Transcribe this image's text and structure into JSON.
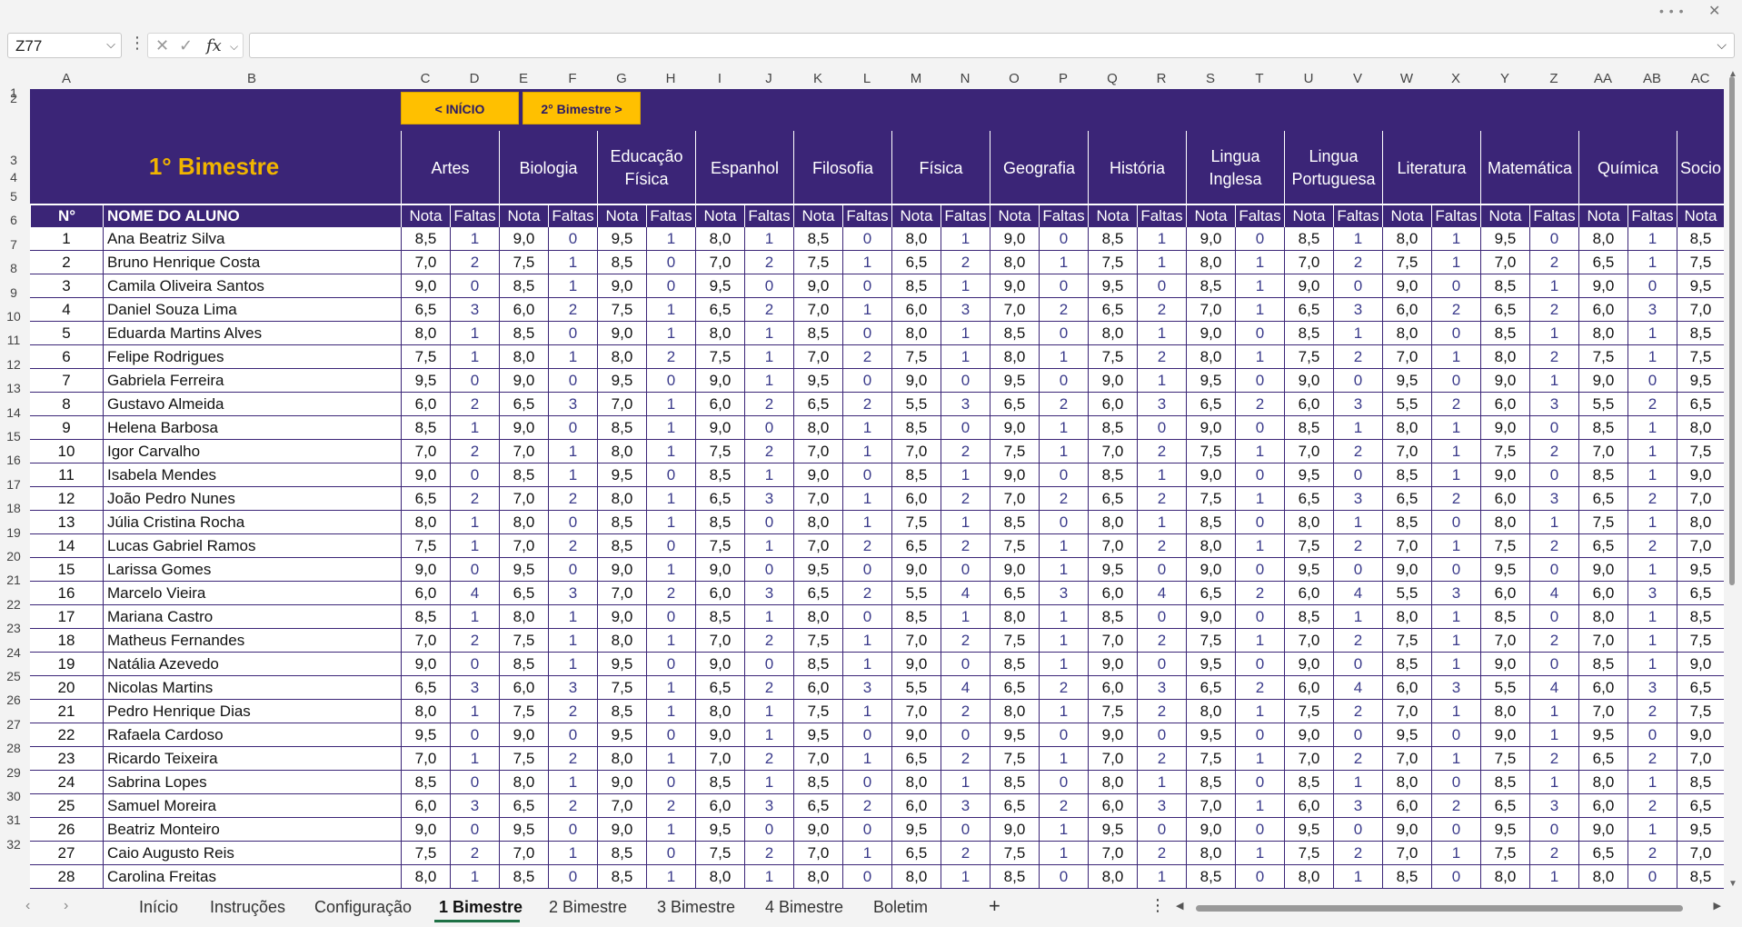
{
  "namebox": "Z77",
  "fx_label": "fx",
  "columns": [
    "A",
    "B",
    "C",
    "D",
    "E",
    "F",
    "G",
    "H",
    "I",
    "J",
    "K",
    "L",
    "M",
    "N",
    "O",
    "P",
    "Q",
    "R",
    "S",
    "T",
    "U",
    "V",
    "W",
    "X",
    "Y",
    "Z",
    "AA",
    "AB",
    "AC"
  ],
  "row_numbers": [
    "1",
    "2",
    "3",
    "4",
    "5",
    "6",
    "7",
    "8",
    "9",
    "10",
    "11",
    "12",
    "13",
    "14",
    "15",
    "16",
    "17",
    "18",
    "19",
    "20",
    "21",
    "22",
    "23",
    "24",
    "25",
    "26",
    "27",
    "28",
    "29",
    "30",
    "31",
    "32"
  ],
  "nav": {
    "inicio": "< INÍCIO",
    "next": "2° Bimestre >"
  },
  "title": "1° Bimestre",
  "subjects": [
    {
      "l1": "Artes",
      "l2": ""
    },
    {
      "l1": "Biologia",
      "l2": ""
    },
    {
      "l1": "Educação",
      "l2": "Física"
    },
    {
      "l1": "Espanhol",
      "l2": ""
    },
    {
      "l1": "Filosofia",
      "l2": ""
    },
    {
      "l1": "Física",
      "l2": ""
    },
    {
      "l1": "Geografia",
      "l2": ""
    },
    {
      "l1": "História",
      "l2": ""
    },
    {
      "l1": "Lingua",
      "l2": "Inglesa"
    },
    {
      "l1": "Lingua",
      "l2": "Portuguesa"
    },
    {
      "l1": "Literatura",
      "l2": ""
    },
    {
      "l1": "Matemática",
      "l2": ""
    },
    {
      "l1": "Química",
      "l2": ""
    },
    {
      "l1": "Socio",
      "l2": ""
    }
  ],
  "headers": {
    "num": "N°",
    "name": "NOME DO ALUNO",
    "nota": "Nota",
    "faltas": "Faltas"
  },
  "students": [
    {
      "n": "1",
      "name": "Ana Beatriz Silva",
      "g": [
        "8,5",
        "1",
        "9,0",
        "0",
        "9,5",
        "1",
        "8,0",
        "1",
        "8,5",
        "0",
        "8,0",
        "1",
        "9,0",
        "0",
        "8,5",
        "1",
        "9,0",
        "0",
        "8,5",
        "1",
        "8,0",
        "1",
        "9,5",
        "0",
        "8,0",
        "1",
        "8,5"
      ]
    },
    {
      "n": "2",
      "name": "Bruno Henrique Costa",
      "g": [
        "7,0",
        "2",
        "7,5",
        "1",
        "8,5",
        "0",
        "7,0",
        "2",
        "7,5",
        "1",
        "6,5",
        "2",
        "8,0",
        "1",
        "7,5",
        "1",
        "8,0",
        "1",
        "7,0",
        "2",
        "7,5",
        "1",
        "7,0",
        "2",
        "6,5",
        "1",
        "7,5"
      ]
    },
    {
      "n": "3",
      "name": "Camila Oliveira Santos",
      "g": [
        "9,0",
        "0",
        "8,5",
        "1",
        "9,0",
        "0",
        "9,5",
        "0",
        "9,0",
        "0",
        "8,5",
        "1",
        "9,0",
        "0",
        "9,5",
        "0",
        "8,5",
        "1",
        "9,0",
        "0",
        "9,0",
        "0",
        "8,5",
        "1",
        "9,0",
        "0",
        "9,5"
      ]
    },
    {
      "n": "4",
      "name": "Daniel Souza Lima",
      "g": [
        "6,5",
        "3",
        "6,0",
        "2",
        "7,5",
        "1",
        "6,5",
        "2",
        "7,0",
        "1",
        "6,0",
        "3",
        "7,0",
        "2",
        "6,5",
        "2",
        "7,0",
        "1",
        "6,5",
        "3",
        "6,0",
        "2",
        "6,5",
        "2",
        "6,0",
        "3",
        "7,0"
      ]
    },
    {
      "n": "5",
      "name": "Eduarda Martins Alves",
      "g": [
        "8,0",
        "1",
        "8,5",
        "0",
        "9,0",
        "1",
        "8,0",
        "1",
        "8,5",
        "0",
        "8,0",
        "1",
        "8,5",
        "0",
        "8,0",
        "1",
        "9,0",
        "0",
        "8,5",
        "1",
        "8,0",
        "0",
        "8,5",
        "1",
        "8,0",
        "1",
        "8,5"
      ]
    },
    {
      "n": "6",
      "name": "Felipe Rodrigues",
      "g": [
        "7,5",
        "1",
        "8,0",
        "1",
        "8,0",
        "2",
        "7,5",
        "1",
        "7,0",
        "2",
        "7,5",
        "1",
        "8,0",
        "1",
        "7,5",
        "2",
        "8,0",
        "1",
        "7,5",
        "2",
        "7,0",
        "1",
        "8,0",
        "2",
        "7,5",
        "1",
        "7,5"
      ]
    },
    {
      "n": "7",
      "name": "Gabriela Ferreira",
      "g": [
        "9,5",
        "0",
        "9,0",
        "0",
        "9,5",
        "0",
        "9,0",
        "1",
        "9,5",
        "0",
        "9,0",
        "0",
        "9,5",
        "0",
        "9,0",
        "1",
        "9,5",
        "0",
        "9,0",
        "0",
        "9,5",
        "0",
        "9,0",
        "1",
        "9,0",
        "0",
        "9,5"
      ]
    },
    {
      "n": "8",
      "name": "Gustavo Almeida",
      "g": [
        "6,0",
        "2",
        "6,5",
        "3",
        "7,0",
        "1",
        "6,0",
        "2",
        "6,5",
        "2",
        "5,5",
        "3",
        "6,5",
        "2",
        "6,0",
        "3",
        "6,5",
        "2",
        "6,0",
        "3",
        "5,5",
        "2",
        "6,0",
        "3",
        "5,5",
        "2",
        "6,5"
      ]
    },
    {
      "n": "9",
      "name": "Helena Barbosa",
      "g": [
        "8,5",
        "1",
        "9,0",
        "0",
        "8,5",
        "1",
        "9,0",
        "0",
        "8,0",
        "1",
        "8,5",
        "0",
        "9,0",
        "1",
        "8,5",
        "0",
        "9,0",
        "0",
        "8,5",
        "1",
        "8,0",
        "1",
        "9,0",
        "0",
        "8,5",
        "1",
        "8,0"
      ]
    },
    {
      "n": "10",
      "name": "Igor Carvalho",
      "g": [
        "7,0",
        "2",
        "7,0",
        "1",
        "8,0",
        "1",
        "7,5",
        "2",
        "7,0",
        "1",
        "7,0",
        "2",
        "7,5",
        "1",
        "7,0",
        "2",
        "7,5",
        "1",
        "7,0",
        "2",
        "7,0",
        "1",
        "7,5",
        "2",
        "7,0",
        "1",
        "7,5"
      ]
    },
    {
      "n": "11",
      "name": "Isabela Mendes",
      "g": [
        "9,0",
        "0",
        "8,5",
        "1",
        "9,5",
        "0",
        "8,5",
        "1",
        "9,0",
        "0",
        "8,5",
        "1",
        "9,0",
        "0",
        "8,5",
        "1",
        "9,0",
        "0",
        "9,5",
        "0",
        "8,5",
        "1",
        "9,0",
        "0",
        "8,5",
        "1",
        "9,0"
      ]
    },
    {
      "n": "12",
      "name": "João Pedro Nunes",
      "g": [
        "6,5",
        "2",
        "7,0",
        "2",
        "8,0",
        "1",
        "6,5",
        "3",
        "7,0",
        "1",
        "6,0",
        "2",
        "7,0",
        "2",
        "6,5",
        "2",
        "7,5",
        "1",
        "6,5",
        "3",
        "6,5",
        "2",
        "6,0",
        "3",
        "6,5",
        "2",
        "7,0"
      ]
    },
    {
      "n": "13",
      "name": "Júlia Cristina Rocha",
      "g": [
        "8,0",
        "1",
        "8,0",
        "0",
        "8,5",
        "1",
        "8,5",
        "0",
        "8,0",
        "1",
        "7,5",
        "1",
        "8,5",
        "0",
        "8,0",
        "1",
        "8,5",
        "0",
        "8,0",
        "1",
        "8,5",
        "0",
        "8,0",
        "1",
        "7,5",
        "1",
        "8,0"
      ]
    },
    {
      "n": "14",
      "name": "Lucas Gabriel Ramos",
      "g": [
        "7,5",
        "1",
        "7,0",
        "2",
        "8,5",
        "0",
        "7,5",
        "1",
        "7,0",
        "2",
        "6,5",
        "2",
        "7,5",
        "1",
        "7,0",
        "2",
        "8,0",
        "1",
        "7,5",
        "2",
        "7,0",
        "1",
        "7,5",
        "2",
        "6,5",
        "2",
        "7,0"
      ]
    },
    {
      "n": "15",
      "name": "Larissa Gomes",
      "g": [
        "9,0",
        "0",
        "9,5",
        "0",
        "9,0",
        "1",
        "9,0",
        "0",
        "9,5",
        "0",
        "9,0",
        "0",
        "9,0",
        "1",
        "9,5",
        "0",
        "9,0",
        "0",
        "9,5",
        "0",
        "9,0",
        "0",
        "9,5",
        "0",
        "9,0",
        "1",
        "9,5"
      ]
    },
    {
      "n": "16",
      "name": "Marcelo Vieira",
      "g": [
        "6,0",
        "4",
        "6,5",
        "3",
        "7,0",
        "2",
        "6,0",
        "3",
        "6,5",
        "2",
        "5,5",
        "4",
        "6,5",
        "3",
        "6,0",
        "4",
        "6,5",
        "2",
        "6,0",
        "4",
        "5,5",
        "3",
        "6,0",
        "4",
        "6,0",
        "3",
        "6,5"
      ]
    },
    {
      "n": "17",
      "name": "Mariana Castro",
      "g": [
        "8,5",
        "1",
        "8,0",
        "1",
        "9,0",
        "0",
        "8,5",
        "1",
        "8,0",
        "0",
        "8,5",
        "1",
        "8,0",
        "1",
        "8,5",
        "0",
        "9,0",
        "0",
        "8,5",
        "1",
        "8,0",
        "1",
        "8,5",
        "0",
        "8,0",
        "1",
        "8,5"
      ]
    },
    {
      "n": "18",
      "name": "Matheus Fernandes",
      "g": [
        "7,0",
        "2",
        "7,5",
        "1",
        "8,0",
        "1",
        "7,0",
        "2",
        "7,5",
        "1",
        "7,0",
        "2",
        "7,5",
        "1",
        "7,0",
        "2",
        "7,5",
        "1",
        "7,0",
        "2",
        "7,5",
        "1",
        "7,0",
        "2",
        "7,0",
        "1",
        "7,5"
      ]
    },
    {
      "n": "19",
      "name": "Natália Azevedo",
      "g": [
        "9,0",
        "0",
        "8,5",
        "1",
        "9,5",
        "0",
        "9,0",
        "0",
        "8,5",
        "1",
        "9,0",
        "0",
        "8,5",
        "1",
        "9,0",
        "0",
        "9,5",
        "0",
        "9,0",
        "0",
        "8,5",
        "1",
        "9,0",
        "0",
        "8,5",
        "1",
        "9,0"
      ]
    },
    {
      "n": "20",
      "name": "Nicolas Martins",
      "g": [
        "6,5",
        "3",
        "6,0",
        "3",
        "7,5",
        "1",
        "6,5",
        "2",
        "6,0",
        "3",
        "5,5",
        "4",
        "6,5",
        "2",
        "6,0",
        "3",
        "6,5",
        "2",
        "6,0",
        "4",
        "6,0",
        "3",
        "5,5",
        "4",
        "6,0",
        "3",
        "6,5"
      ]
    },
    {
      "n": "21",
      "name": "Pedro Henrique Dias",
      "g": [
        "8,0",
        "1",
        "7,5",
        "2",
        "8,5",
        "1",
        "8,0",
        "1",
        "7,5",
        "1",
        "7,0",
        "2",
        "8,0",
        "1",
        "7,5",
        "2",
        "8,0",
        "1",
        "7,5",
        "2",
        "7,0",
        "1",
        "8,0",
        "1",
        "7,0",
        "2",
        "7,5"
      ]
    },
    {
      "n": "22",
      "name": "Rafaela Cardoso",
      "g": [
        "9,5",
        "0",
        "9,0",
        "0",
        "9,5",
        "0",
        "9,0",
        "1",
        "9,5",
        "0",
        "9,0",
        "0",
        "9,5",
        "0",
        "9,0",
        "0",
        "9,5",
        "0",
        "9,0",
        "0",
        "9,5",
        "0",
        "9,0",
        "1",
        "9,5",
        "0",
        "9,0"
      ]
    },
    {
      "n": "23",
      "name": "Ricardo Teixeira",
      "g": [
        "7,0",
        "1",
        "7,5",
        "2",
        "8,0",
        "1",
        "7,0",
        "2",
        "7,0",
        "1",
        "6,5",
        "2",
        "7,5",
        "1",
        "7,0",
        "2",
        "7,5",
        "1",
        "7,0",
        "2",
        "7,0",
        "1",
        "7,5",
        "2",
        "6,5",
        "2",
        "7,0"
      ]
    },
    {
      "n": "24",
      "name": "Sabrina Lopes",
      "g": [
        "8,5",
        "0",
        "8,0",
        "1",
        "9,0",
        "0",
        "8,5",
        "1",
        "8,5",
        "0",
        "8,0",
        "1",
        "8,5",
        "0",
        "8,0",
        "1",
        "8,5",
        "0",
        "8,5",
        "1",
        "8,0",
        "0",
        "8,5",
        "1",
        "8,0",
        "1",
        "8,5"
      ]
    },
    {
      "n": "25",
      "name": "Samuel Moreira",
      "g": [
        "6,0",
        "3",
        "6,5",
        "2",
        "7,0",
        "2",
        "6,0",
        "3",
        "6,5",
        "2",
        "6,0",
        "3",
        "6,5",
        "2",
        "6,0",
        "3",
        "7,0",
        "1",
        "6,0",
        "3",
        "6,0",
        "2",
        "6,5",
        "3",
        "6,0",
        "2",
        "6,5"
      ]
    },
    {
      "n": "26",
      "name": "Beatriz Monteiro",
      "g": [
        "9,0",
        "0",
        "9,5",
        "0",
        "9,0",
        "1",
        "9,5",
        "0",
        "9,0",
        "0",
        "9,5",
        "0",
        "9,0",
        "1",
        "9,5",
        "0",
        "9,0",
        "0",
        "9,5",
        "0",
        "9,0",
        "0",
        "9,5",
        "0",
        "9,0",
        "1",
        "9,5"
      ]
    },
    {
      "n": "27",
      "name": "Caio Augusto Reis",
      "g": [
        "7,5",
        "2",
        "7,0",
        "1",
        "8,5",
        "0",
        "7,5",
        "2",
        "7,0",
        "1",
        "6,5",
        "2",
        "7,5",
        "1",
        "7,0",
        "2",
        "8,0",
        "1",
        "7,5",
        "2",
        "7,0",
        "1",
        "7,5",
        "2",
        "6,5",
        "2",
        "7,0"
      ]
    },
    {
      "n": "28",
      "name": "Carolina Freitas",
      "g": [
        "8,0",
        "1",
        "8,5",
        "0",
        "8,5",
        "1",
        "8,0",
        "1",
        "8,0",
        "0",
        "8,0",
        "1",
        "8,5",
        "0",
        "8,0",
        "1",
        "8,5",
        "0",
        "8,0",
        "1",
        "8,5",
        "0",
        "8,0",
        "1",
        "8,0",
        "0",
        "8,5"
      ]
    }
  ],
  "tabs": [
    "Início",
    "Instruções",
    "Configuração",
    "1 Bimestre",
    "2 Bimestre",
    "3 Bimestre",
    "4 Bimestre",
    "Boletim"
  ],
  "active_tab": "1 Bimestre",
  "colors": {
    "header_bg": "#3b2577",
    "accent": "#ffc000",
    "title": "#f0b400"
  }
}
